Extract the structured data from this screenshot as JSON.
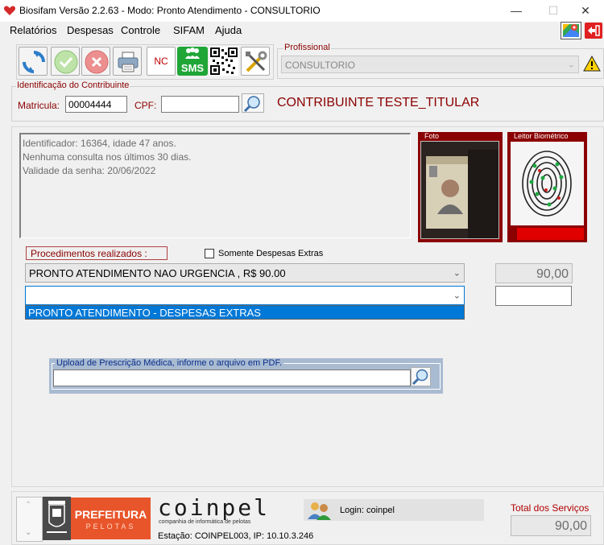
{
  "window": {
    "title": "Biosifam Versão 2.2.63 - Modo: Pronto Atendimento - CONSULTORIO"
  },
  "menu": [
    "Relatórios",
    "Despesas",
    "Controle",
    "SIFAM",
    "Ajuda"
  ],
  "toolbar": {
    "nc_label": "NC",
    "sms_label": "SMS"
  },
  "profissional": {
    "label": "Profissional",
    "value": "CONSULTORIO"
  },
  "contribuinte": {
    "group_label": "Identificação do Contribuinte",
    "matricula_label": "Matricula:",
    "matricula_value": "00004444",
    "cpf_label": "CPF:",
    "cpf_value": "",
    "name": "CONTRIBUINTE TESTE_TITULAR"
  },
  "info_lines": [
    "Identificador: 16364, idade 47 anos.",
    "Nenhuma consulta nos últimos 30 dias.",
    "Validade da senha: 20/06/2022"
  ],
  "foto_label": "Foto",
  "leitor_label": "Leitor Biométrico",
  "procedimentos": {
    "label": "Procedimentos realizados :",
    "somente_label": "Somente Despesas Extras",
    "somente_checked": false,
    "selected": "PRONTO ATENDIMENTO NAO URGENCIA , R$ 90.00",
    "selected_value": "90,00",
    "second_value": "",
    "dropdown_option": "PRONTO ATENDIMENTO - DESPESAS EXTRAS"
  },
  "upload": {
    "label": "Upload de Prescrição Médica, informe o arquivo em PDF.",
    "value": ""
  },
  "footer": {
    "prefeitura_line1": "PREFEITURA",
    "prefeitura_line2": "PELOTAS",
    "coinpel": "coinpel",
    "coinpel_sub": "companhia de informática de pelotas",
    "login": "Login: coinpel",
    "estacao": "Estação: COINPEL003, IP: 10.10.3.246",
    "total_label": "Total dos Serviços",
    "total_value": "90,00"
  },
  "colors": {
    "dark_red": "#8b0000",
    "selection_blue": "#0078d7"
  }
}
